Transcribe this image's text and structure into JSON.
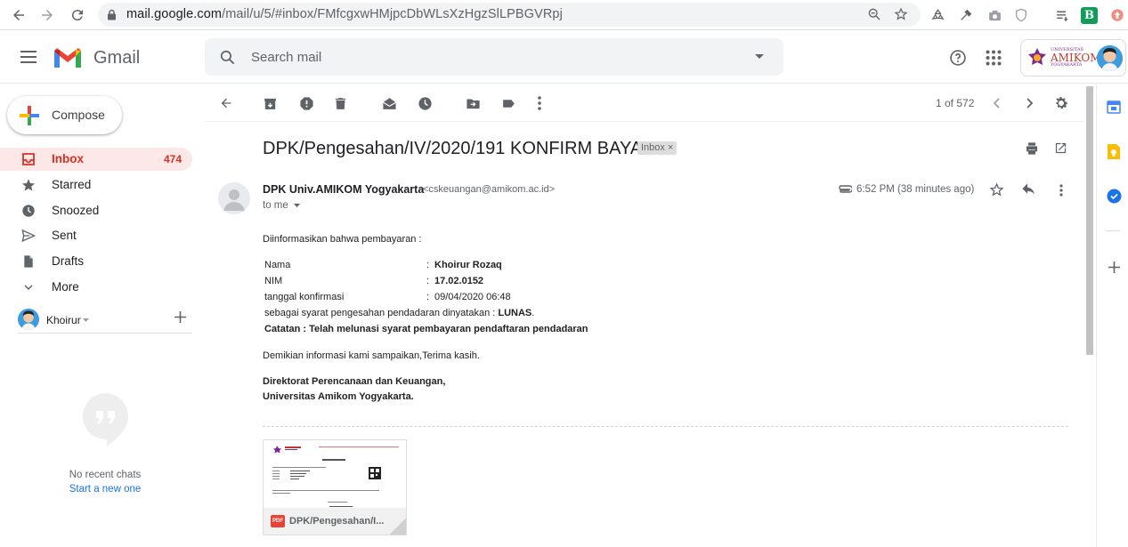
{
  "browser": {
    "url_host": "mail.google.com",
    "url_path": "/mail/u/5/#inbox/FMfcgxwHMjpcDbWLsXzHgzSlLPBGVRpj"
  },
  "header": {
    "app_name": "Gmail",
    "search_placeholder": "Search mail",
    "account_org_line1": "UNIVERSITAS",
    "account_org_line2": "AMIKOM",
    "account_org_line3": "YOGYAKARTA"
  },
  "sidebar": {
    "compose_label": "Compose",
    "items": [
      {
        "label": "Inbox",
        "count": "474",
        "icon": "inbox-icon"
      },
      {
        "label": "Starred",
        "count": "",
        "icon": "star-icon"
      },
      {
        "label": "Snoozed",
        "count": "",
        "icon": "clock-icon"
      },
      {
        "label": "Sent",
        "count": "",
        "icon": "send-icon"
      },
      {
        "label": "Drafts",
        "count": "",
        "icon": "draft-icon"
      },
      {
        "label": "More",
        "count": "",
        "icon": "chevron-down-icon"
      }
    ],
    "hangouts_user": "Khoirur",
    "no_chats": "No recent chats",
    "start_chat": "Start a new one"
  },
  "toolbar": {
    "pager": "1 of 572"
  },
  "email": {
    "subject": "DPK/Pengesahan/IV/2020/191 KONFIRM BAYAR",
    "label_chip": "Inbox",
    "sender_name": "DPK Univ.AMIKOM Yogyakarta",
    "sender_email": "<cskeuangan@amikom.ac.id>",
    "to": "to me",
    "time": "6:52 PM (38 minutes ago)",
    "intro": "Diinformasikan bahwa pembayaran :",
    "rows": [
      {
        "key": "Nama",
        "sep": ":",
        "value": "Khoirur Rozaq"
      },
      {
        "key": "NIM",
        "sep": ":",
        "value": "17.02.0152"
      },
      {
        "key": "tanggal konfirmasi",
        "sep": ":",
        "value": "09/04/2020 06:48"
      }
    ],
    "statement_prefix": "sebagai syarat pengesahan pendadaran dinyatakan : ",
    "statement_status": "LUNAS",
    "statement_suffix": ".",
    "note": "Catatan : Telah melunasi syarat pembayaran pendaftaran pendadaran",
    "closing": "Demikian informasi kami sampaikan,Terima kasih.",
    "signature_line1": "Direktorat Perencanaan dan Keuangan,",
    "signature_line2": "Universitas Amikom Yogyakarta.",
    "attachment_name": "DPK/Pengesahan/I...",
    "attachment_type": "PDF"
  },
  "colors": {
    "gmail_red": "#d93025",
    "inbox_highlight": "#fce8e6",
    "link_blue": "#1a73e8",
    "pdf_red": "#ea4335"
  }
}
